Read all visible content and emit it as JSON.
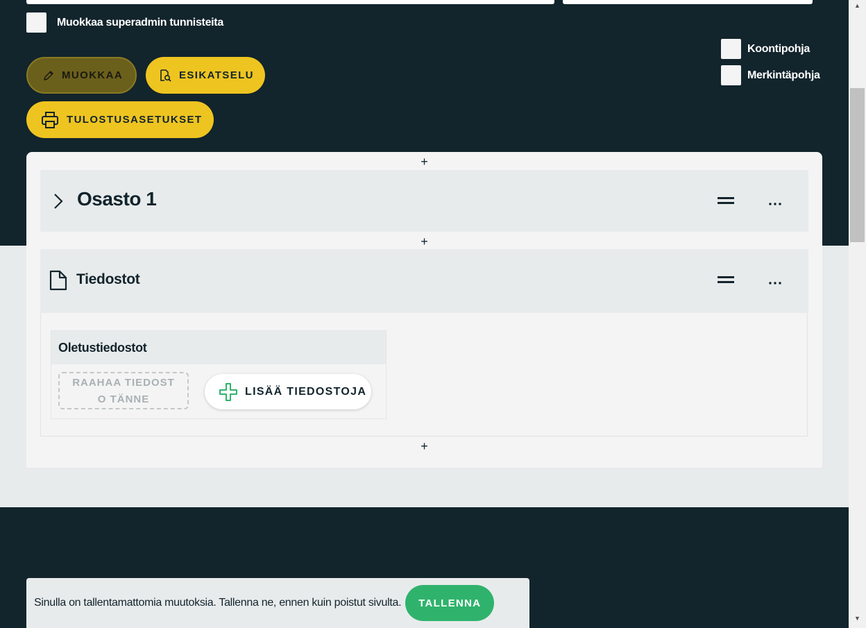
{
  "options": {
    "superadmin_label": "Muokkaa superadmin tunnisteita",
    "koontipohja_label": "Koontipohja",
    "merkintapohja_label": "Merkintäpohja"
  },
  "toolbar": {
    "edit_label": "MUOKKAA",
    "preview_label": "ESIKATSELU",
    "print_settings_label": "TULOSTUSASETUKSET"
  },
  "editor": {
    "add_symbol": "+",
    "drag_symbol": "═",
    "more_symbol": "···",
    "sections": [
      {
        "title": "Osasto 1",
        "icon": "chevron-right-icon"
      },
      {
        "title": "Tiedostot",
        "icon": "file-icon"
      }
    ],
    "files": {
      "card_title": "Oletustiedostot",
      "drop_zone_line1": "RAAHAA TIEDOST",
      "drop_zone_line2": "O TÄNNE",
      "add_button_label": "LISÄÄ TIEDOSTOJA"
    }
  },
  "snackbar": {
    "message": "Sinulla on tallentamattomia muutoksia. Tallenna ne, ennen kuin poistut sivulta.",
    "save_label": "TALLENNA"
  },
  "colors": {
    "dark_bg": "#12242c",
    "accent_yellow": "#eec420",
    "save_green": "#2fb36c",
    "panel_gray": "#e8ebec"
  }
}
